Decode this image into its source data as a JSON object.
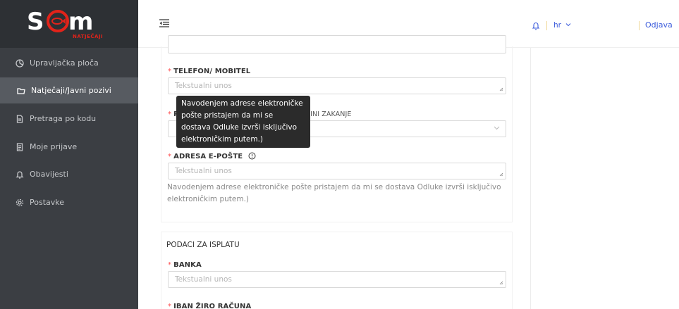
{
  "app": {
    "logo_tagline": "NATJEČAJI"
  },
  "sidebar": {
    "items": [
      {
        "label": "Upravljačka ploča",
        "icon": "dashboard-icon"
      },
      {
        "label": "Natječaji/Javni pozivi",
        "icon": "folder-icon",
        "active": true
      },
      {
        "label": "Pretraga po kodu",
        "icon": "document-icon"
      },
      {
        "label": "Moje prijave",
        "icon": "file-list-icon"
      },
      {
        "label": "Obavijesti",
        "icon": "bell-icon"
      },
      {
        "label": "Postavke",
        "icon": "gear-icon"
      }
    ]
  },
  "topbar": {
    "language": "hr",
    "logout": "Odjava"
  },
  "form": {
    "telefon_label": "TELEFON/ MOBITEL",
    "telefon_placeholder": "Tekstualni unos",
    "dostava_label_visible": "P",
    "dostava_label_tail": "OPĆINI ZAKANJE",
    "email_label": "ADRESA E-POŠTE",
    "email_placeholder": "Tekstualni unos",
    "email_help": "Navodenjem adrese elektroničke pošte pristajem da mi se dostava Odluke izvrši isključivo elektroničkim putem.)",
    "tooltip": "Navodenjem adrese elektroničke\npošte pristajem da mi se\ndostava Odluke izvrši isključivo\nelektroničkim putem.)"
  },
  "payment": {
    "section_title": "PODACI ZA ISPLATU",
    "banka_label": "BANKA",
    "banka_placeholder": "Tekstualni unos",
    "iban_label": "IBAN ŽIRO RAČUNA"
  },
  "colors": {
    "sidebar_bg": "#3b3e43",
    "sidebar_active": "#575b61",
    "brand_red": "#e2231a",
    "link_blue": "#3b5bdb",
    "required": "#ff4d4f"
  }
}
